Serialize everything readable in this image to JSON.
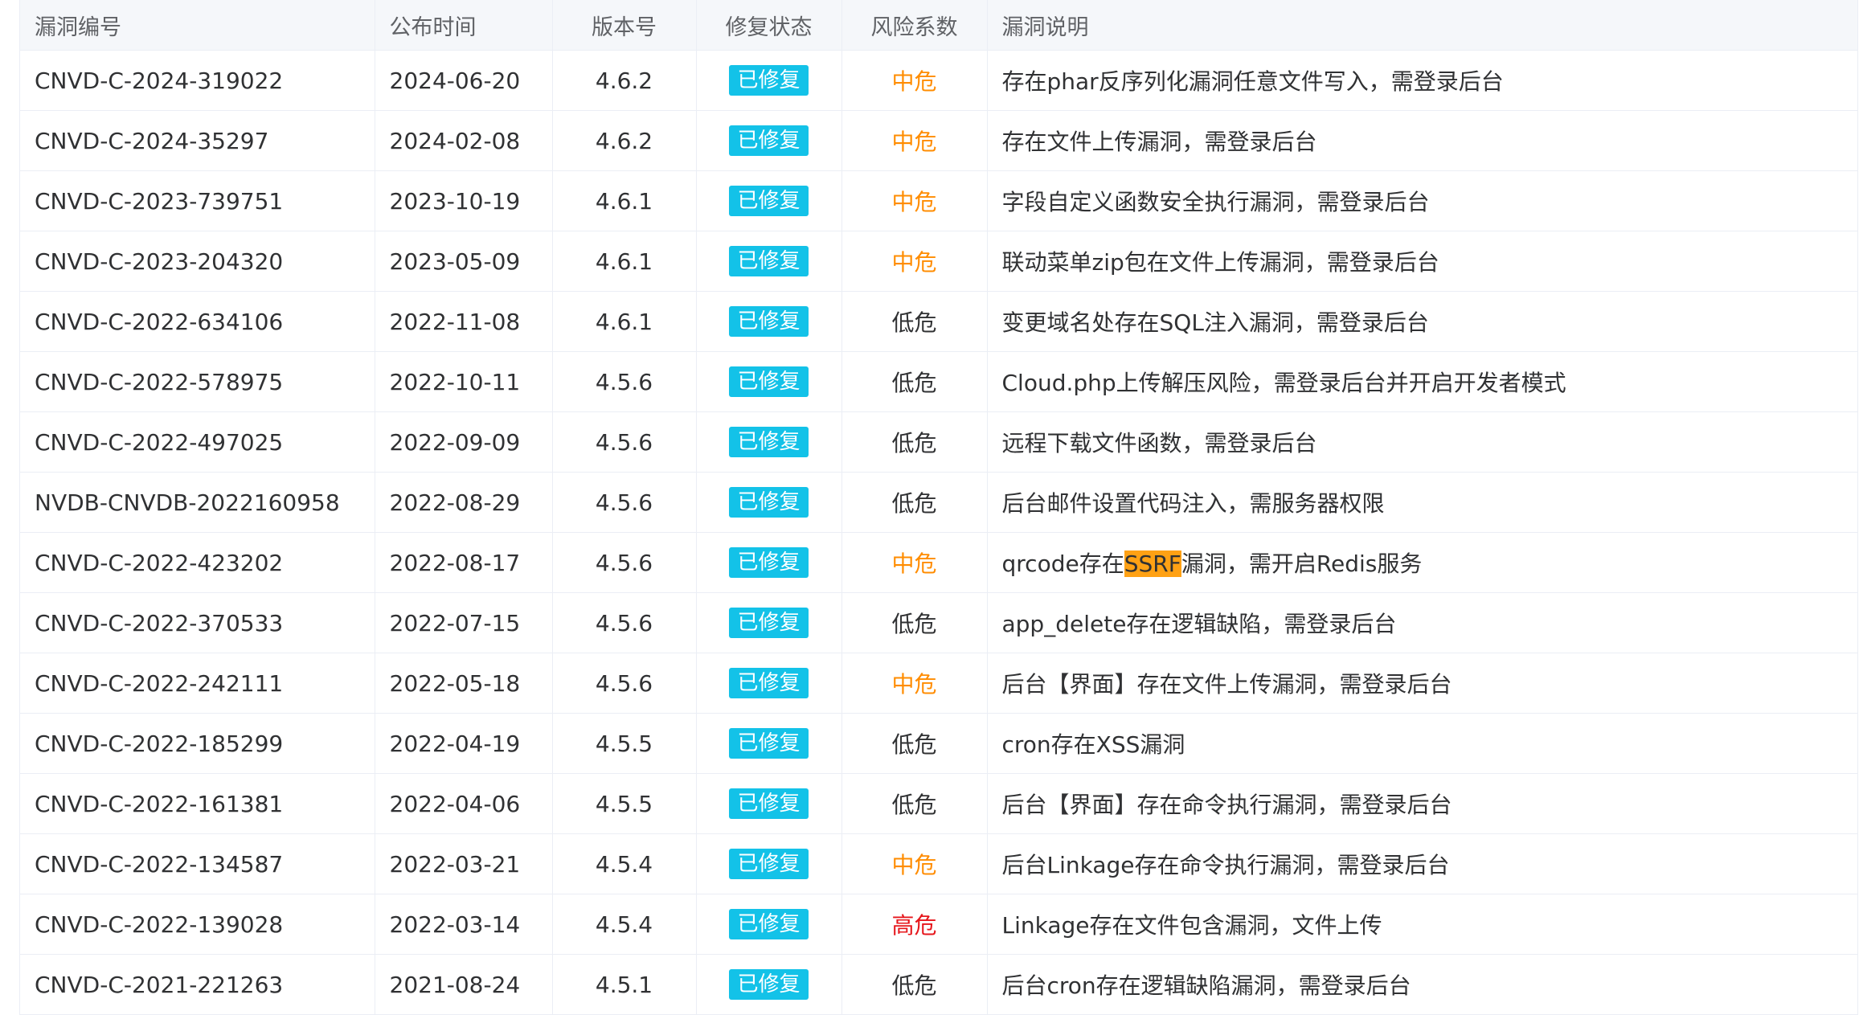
{
  "header": {
    "id": "漏洞编号",
    "date": "公布时间",
    "version": "版本号",
    "status": "修复状态",
    "risk": "风险系数",
    "desc": "漏洞说明"
  },
  "colors": {
    "badge": "#13c2e8",
    "risk_mid": "#ff8c00",
    "risk_low": "#303133",
    "risk_high": "#e6161b",
    "highlight": "#ffa114"
  },
  "rows": [
    {
      "id": "CNVD-C-2024-319022",
      "date": "2024-06-20",
      "version": "4.6.2",
      "status": "已修复",
      "risk": "中危",
      "risk_level": "mid",
      "desc": "存在phar反序列化漏洞任意文件写入，需登录后台"
    },
    {
      "id": "CNVD-C-2024-35297",
      "date": "2024-02-08",
      "version": "4.6.2",
      "status": "已修复",
      "risk": "中危",
      "risk_level": "mid",
      "desc": "存在文件上传漏洞，需登录后台"
    },
    {
      "id": "CNVD-C-2023-739751",
      "date": "2023-10-19",
      "version": "4.6.1",
      "status": "已修复",
      "risk": "中危",
      "risk_level": "mid",
      "desc": "字段自定义函数安全执行漏洞，需登录后台"
    },
    {
      "id": "CNVD-C-2023-204320",
      "date": "2023-05-09",
      "version": "4.6.1",
      "status": "已修复",
      "risk": "中危",
      "risk_level": "mid",
      "desc": "联动菜单zip包在文件上传漏洞，需登录后台"
    },
    {
      "id": "CNVD-C-2022-634106",
      "date": "2022-11-08",
      "version": "4.6.1",
      "status": "已修复",
      "risk": "低危",
      "risk_level": "low",
      "desc": "变更域名处存在SQL注入漏洞，需登录后台"
    },
    {
      "id": "CNVD-C-2022-578975",
      "date": "2022-10-11",
      "version": "4.5.6",
      "status": "已修复",
      "risk": "低危",
      "risk_level": "low",
      "desc": "Cloud.php上传解压风险，需登录后台并开启开发者模式"
    },
    {
      "id": "CNVD-C-2022-497025",
      "date": "2022-09-09",
      "version": "4.5.6",
      "status": "已修复",
      "risk": "低危",
      "risk_level": "low",
      "desc": "远程下载文件函数，需登录后台"
    },
    {
      "id": "NVDB-CNVDB-2022160958",
      "date": "2022-08-29",
      "version": "4.5.6",
      "status": "已修复",
      "risk": "低危",
      "risk_level": "low",
      "desc": "后台邮件设置代码注入，需服务器权限"
    },
    {
      "id": "CNVD-C-2022-423202",
      "date": "2022-08-17",
      "version": "4.5.6",
      "status": "已修复",
      "risk": "中危",
      "risk_level": "mid",
      "desc": "qrcode存在SSRF漏洞，需开启Redis服务",
      "desc_parts": [
        "qrcode存在",
        "SSRF",
        "漏洞，需开启Redis服务"
      ]
    },
    {
      "id": "CNVD-C-2022-370533",
      "date": "2022-07-15",
      "version": "4.5.6",
      "status": "已修复",
      "risk": "低危",
      "risk_level": "low",
      "desc": "app_delete存在逻辑缺陷，需登录后台"
    },
    {
      "id": "CNVD-C-2022-242111",
      "date": "2022-05-18",
      "version": "4.5.6",
      "status": "已修复",
      "risk": "中危",
      "risk_level": "mid",
      "desc": "后台【界面】存在文件上传漏洞，需登录后台"
    },
    {
      "id": "CNVD-C-2022-185299",
      "date": "2022-04-19",
      "version": "4.5.5",
      "status": "已修复",
      "risk": "低危",
      "risk_level": "low",
      "desc": "cron存在XSS漏洞"
    },
    {
      "id": "CNVD-C-2022-161381",
      "date": "2022-04-06",
      "version": "4.5.5",
      "status": "已修复",
      "risk": "低危",
      "risk_level": "low",
      "desc": "后台【界面】存在命令执行漏洞，需登录后台"
    },
    {
      "id": "CNVD-C-2022-134587",
      "date": "2022-03-21",
      "version": "4.5.4",
      "status": "已修复",
      "risk": "中危",
      "risk_level": "mid",
      "desc": "后台Linkage存在命令执行漏洞，需登录后台"
    },
    {
      "id": "CNVD-C-2022-139028",
      "date": "2022-03-14",
      "version": "4.5.4",
      "status": "已修复",
      "risk": "高危",
      "risk_level": "high",
      "desc": "Linkage存在文件包含漏洞，文件上传"
    },
    {
      "id": "CNVD-C-2021-221263",
      "date": "2021-08-24",
      "version": "4.5.1",
      "status": "已修复",
      "risk": "低危",
      "risk_level": "low",
      "desc": "后台cron存在逻辑缺陷漏洞，需登录后台"
    }
  ]
}
